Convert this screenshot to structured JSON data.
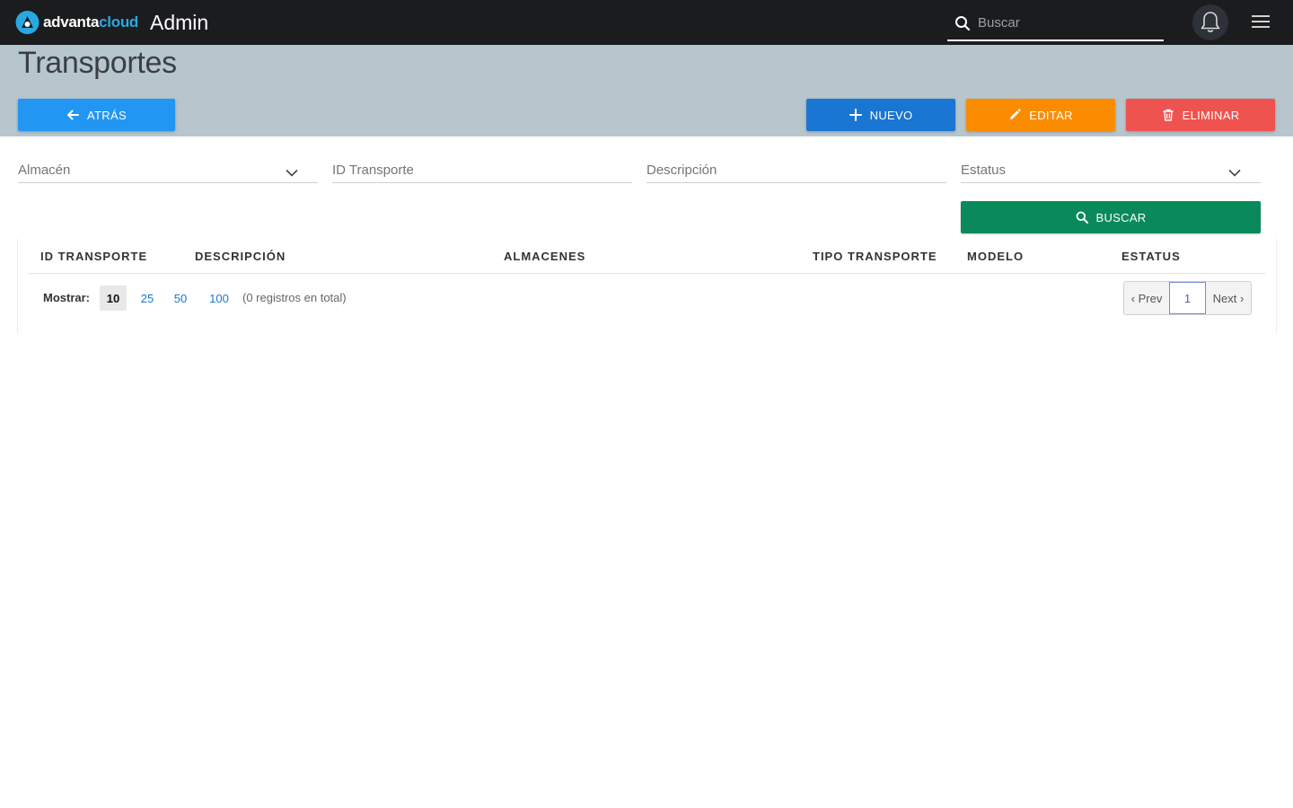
{
  "brand": {
    "logo_text_a": "advanta",
    "logo_text_b": "cloud",
    "app_title": "Admin"
  },
  "search": {
    "placeholder": "Buscar"
  },
  "page": {
    "title": "Transportes"
  },
  "actions": {
    "back": "ATRÁS",
    "new": "NUEVO",
    "edit": "EDITAR",
    "delete": "ELIMINAR"
  },
  "filters": {
    "almacen": "Almacén",
    "id_transporte": "ID Transporte",
    "descripcion": "Descripción",
    "estatus": "Estatus",
    "search_button": "BUSCAR"
  },
  "table": {
    "columns": [
      "ID TRANSPORTE",
      "DESCRIPCIÓN",
      "ALMACENES",
      "TIPO TRANSPORTE",
      "MODELO",
      "ESTATUS"
    ],
    "rows": []
  },
  "pagination": {
    "show_label": "Mostrar:",
    "page_sizes": [
      "10",
      "25",
      "50",
      "100"
    ],
    "selected_size": "10",
    "total_text": "(0 registros en total)",
    "prev": "‹ Prev",
    "current": "1",
    "next": "Next ›"
  },
  "colors": {
    "topbar": "#1b1c1e",
    "header_band": "#b7c6cd",
    "back": "#2196f3",
    "new": "#1976d2",
    "edit": "#fb8c00",
    "delete": "#ef5350",
    "search": "#0a8a5a"
  },
  "icons": [
    "logo-icon",
    "search-icon",
    "bell-icon",
    "menu-icon",
    "arrow-left-icon",
    "plus-icon",
    "pencil-icon",
    "trash-icon",
    "chevron-down-icon"
  ]
}
